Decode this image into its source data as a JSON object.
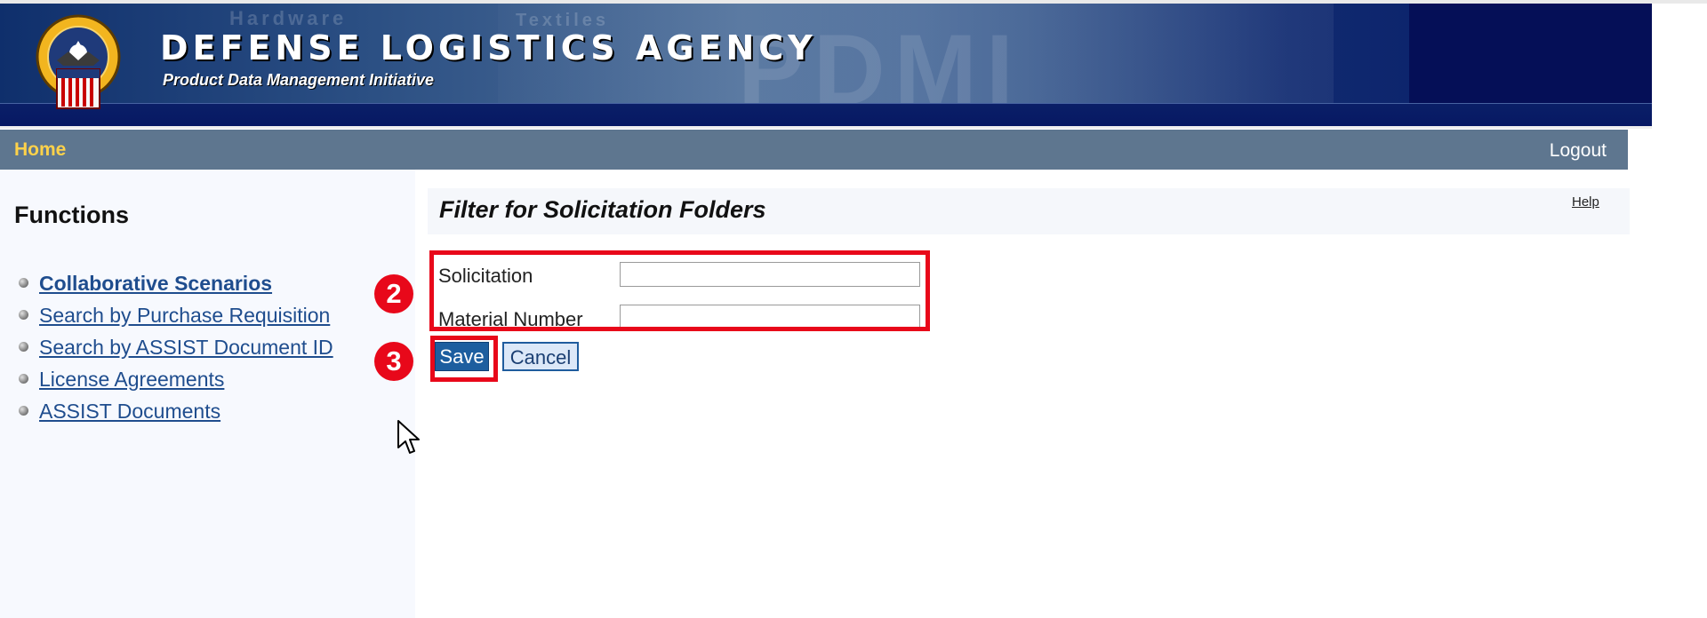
{
  "banner": {
    "title": "DEFENSE LOGISTICS AGENCY",
    "subtitle": "Product Data Management Initiative",
    "watermarks": [
      "Hardware",
      "Textiles",
      "PDMI"
    ],
    "seal_icon": "dla-seal-icon",
    "colors": {
      "background": "#102a70",
      "text": "#ffffff"
    }
  },
  "nav": {
    "home": "Home",
    "logout": "Logout",
    "colors": {
      "background": "#5e768f",
      "home": "#ffd24a",
      "logout": "#ffffff"
    }
  },
  "sidebar": {
    "title": "Functions",
    "items": [
      {
        "label": "Collaborative Scenarios",
        "active": true
      },
      {
        "label": "Search by Purchase Requisition",
        "active": false
      },
      {
        "label": "Search by ASSIST Document ID",
        "active": false
      },
      {
        "label": "License Agreements",
        "active": false
      },
      {
        "label": "ASSIST Documents",
        "active": false
      }
    ]
  },
  "main": {
    "title": "Filter for Solicitation Folders",
    "help": "Help",
    "fields": [
      {
        "label": "Solicitation",
        "value": "",
        "placeholder": ""
      },
      {
        "label": "Material Number",
        "value": "",
        "placeholder": ""
      }
    ],
    "buttons": {
      "save": "Save",
      "cancel": "Cancel"
    }
  },
  "annotations": [
    {
      "number": "2",
      "target": "form-fields"
    },
    {
      "number": "3",
      "target": "save-button"
    }
  ],
  "annotation_color": "#e8081a",
  "link_color": "#1f4d8e"
}
